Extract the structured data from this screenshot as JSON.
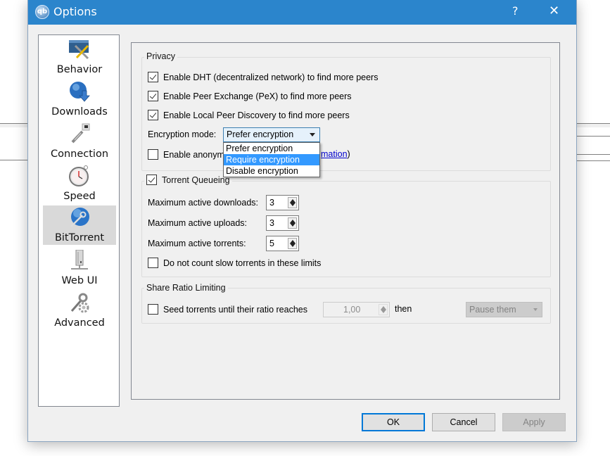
{
  "window": {
    "title": "Options",
    "app_icon_text": "qb",
    "help_label": "?",
    "close_label": "✕"
  },
  "sidebar": {
    "selected": "BitTorrent",
    "items": [
      {
        "label": "Behavior",
        "icon": "behavior-icon"
      },
      {
        "label": "Downloads",
        "icon": "downloads-globe-icon"
      },
      {
        "label": "Connection",
        "icon": "connection-plug-icon"
      },
      {
        "label": "Speed",
        "icon": "stopwatch-icon"
      },
      {
        "label": "BitTorrent",
        "icon": "bittorrent-globe-wrench-icon"
      },
      {
        "label": "Web UI",
        "icon": "webui-server-icon"
      },
      {
        "label": "Advanced",
        "icon": "advanced-wrench-gear-icon"
      }
    ]
  },
  "privacy": {
    "title": "Privacy",
    "dht": {
      "label": "Enable DHT (decentralized network) to find more peers",
      "checked": true
    },
    "pex": {
      "label": "Enable Peer Exchange (PeX) to find more peers",
      "checked": true
    },
    "lpd": {
      "label": "Enable Local Peer Discovery to find more peers",
      "checked": true
    },
    "encryption_label": "Encryption mode:",
    "encryption_value": "Prefer encryption",
    "encryption_options": [
      "Prefer encryption",
      "Require encryption",
      "Disable encryption"
    ],
    "encryption_highlighted": "Require encryption",
    "anon_label": "Enable anonym",
    "anon_link_tail": "mation",
    "anon_close_paren": ")",
    "anon_checked": false
  },
  "queueing": {
    "title": "Torrent Queueing",
    "checked": true,
    "max_downloads_label": "Maximum active downloads:",
    "max_downloads": "3",
    "max_uploads_label": "Maximum active uploads:",
    "max_uploads": "3",
    "max_torrents_label": "Maximum active torrents:",
    "max_torrents": "5",
    "slow_label": "Do not count slow torrents in these limits",
    "slow_checked": false
  },
  "share_ratio": {
    "title": "Share Ratio Limiting",
    "seed_label": "Seed torrents until their ratio reaches",
    "seed_checked": false,
    "ratio_value": "1,00",
    "then_label": "then",
    "action_value": "Pause them"
  },
  "buttons": {
    "ok": "OK",
    "cancel": "Cancel",
    "apply": "Apply"
  }
}
